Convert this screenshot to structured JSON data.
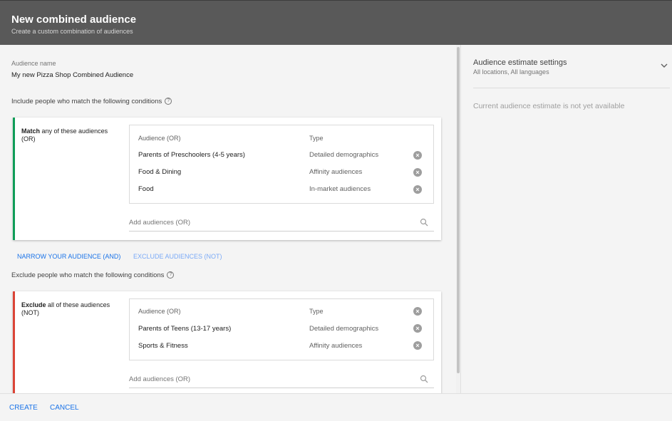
{
  "header": {
    "title": "New combined audience",
    "subtitle": "Create a custom combination of audiences"
  },
  "form": {
    "audience_name_label": "Audience name",
    "audience_name_value": "My new Pizza Shop Combined Audience",
    "include_heading": "Include people who match the following conditions",
    "exclude_heading": "Exclude people who match the following conditions"
  },
  "include_card": {
    "label_bold": "Match",
    "label_rest": " any of these audiences (OR)",
    "col_audience": "Audience (OR)",
    "col_type": "Type",
    "rows": [
      {
        "name": "Parents of Preschoolers (4-5 years)",
        "type": "Detailed demographics"
      },
      {
        "name": "Food & Dining",
        "type": "Affinity audiences"
      },
      {
        "name": "Food",
        "type": "In-market audiences"
      }
    ],
    "add_placeholder": "Add audiences (OR)"
  },
  "actions": {
    "narrow": "NARROW YOUR AUDIENCE (AND)",
    "exclude": "EXCLUDE AUDIENCES (NOT)"
  },
  "exclude_card": {
    "label_bold": "Exclude",
    "label_rest": " all of these audiences (NOT)",
    "col_audience": "Audience (OR)",
    "col_type": "Type",
    "rows": [
      {
        "name": "Parents of Teens (13-17 years)",
        "type": "Detailed demographics"
      },
      {
        "name": "Sports & Fitness",
        "type": "Affinity audiences"
      }
    ],
    "add_placeholder": "Add audiences (OR)"
  },
  "estimate": {
    "title": "Audience estimate settings",
    "subtitle": "All locations, All languages",
    "status": "Current audience estimate is not yet available"
  },
  "footer": {
    "create": "CREATE",
    "cancel": "CANCEL"
  },
  "colors": {
    "header_bg": "#595959",
    "include_accent": "#0f9d58",
    "exclude_accent": "#db4437",
    "link_active": "#1a73e8",
    "link_muted": "#7baaf7"
  },
  "icons": {
    "help": "help-circle-icon",
    "remove": "remove-circle-icon",
    "search": "search-icon",
    "expand": "chevron-down-icon"
  }
}
